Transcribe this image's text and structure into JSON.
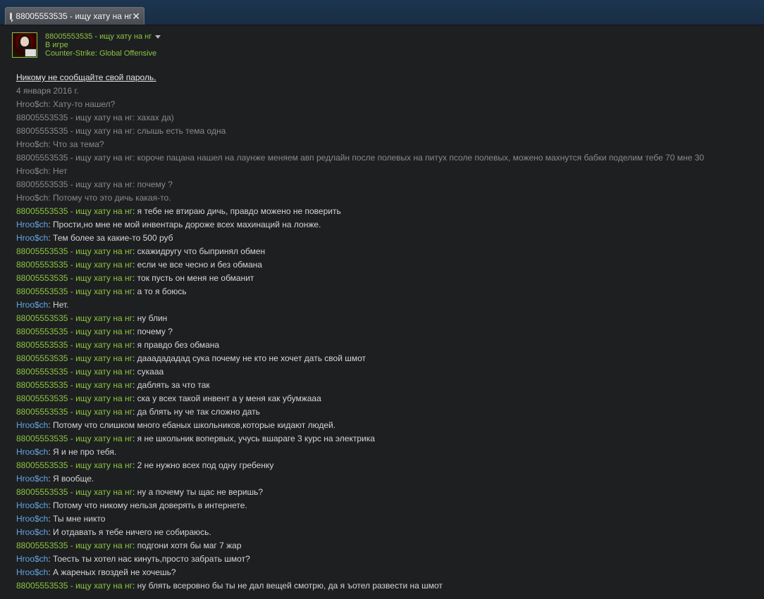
{
  "tab": {
    "title": "88005553535 - ищу хату на нг",
    "close": "✕"
  },
  "header": {
    "name": "88005553535 - ищу хату на нг",
    "status": "В игре",
    "game": "Counter-Strike: Global Offensive"
  },
  "warning": "Никому не сообщайте свой пароль.",
  "date": "4 января 2016 г.",
  "colors": {
    "friend": "#8bc53f",
    "self": "#62a7e3",
    "history": "#8a8a8a"
  },
  "messages": [
    {
      "sender": "Hroo$ch",
      "text": "Хату-то нашел?",
      "old": true,
      "self": true
    },
    {
      "sender": "88005553535 - ищу хату на нг",
      "text": "хахах да)",
      "old": true,
      "self": false
    },
    {
      "sender": "88005553535 - ищу хату на нг",
      "text": "слышь есть тема одна",
      "old": true,
      "self": false
    },
    {
      "sender": "Hroo$ch",
      "text": "Что за тема?",
      "old": true,
      "self": true
    },
    {
      "sender": "88005553535 - ищу хату на нг",
      "text": "короче пацана нашел на лаунже меняем авп редлайн после полевых на питух псоле полевых, можено махнутся бабки поделим тебе 70 мне 30",
      "old": true,
      "self": false
    },
    {
      "sender": "Hroo$ch",
      "text": "Нет",
      "old": true,
      "self": true
    },
    {
      "sender": "88005553535 - ищу хату на нг",
      "text": "почему ?",
      "old": true,
      "self": false
    },
    {
      "sender": "Hroo$ch",
      "text": "Потому что это дичь какая-то.",
      "old": true,
      "self": true
    },
    {
      "sender": "88005553535 - ищу хату на нг",
      "text": "я тебе не втираю дичь, правдо можено не поверить",
      "old": false,
      "self": false
    },
    {
      "sender": "Hroo$ch",
      "text": "Прости,но мне не мой инвентарь дороже всех махинаций на лонже.",
      "old": false,
      "self": true
    },
    {
      "sender": "Hroo$ch",
      "text": "Тем более за какие-то 500 руб",
      "old": false,
      "self": true
    },
    {
      "sender": "88005553535 - ищу хату на нг",
      "text": "скажидругу что быпринял обмен",
      "old": false,
      "self": false
    },
    {
      "sender": "88005553535 - ищу хату на нг",
      "text": "если че все чесно и без обмана",
      "old": false,
      "self": false
    },
    {
      "sender": "88005553535 - ищу хату на нг",
      "text": "ток пусть он меня не обманит",
      "old": false,
      "self": false
    },
    {
      "sender": "88005553535 - ищу хату на нг",
      "text": "а то я боюсь",
      "old": false,
      "self": false
    },
    {
      "sender": "Hroo$ch",
      "text": "Нет.",
      "old": false,
      "self": true
    },
    {
      "sender": "88005553535 - ищу хату на нг",
      "text": "ну блин",
      "old": false,
      "self": false
    },
    {
      "sender": "88005553535 - ищу хату на нг",
      "text": "почему ?",
      "old": false,
      "self": false
    },
    {
      "sender": "88005553535 - ищу хату на нг",
      "text": "я правдо без обмана",
      "old": false,
      "self": false
    },
    {
      "sender": "88005553535 - ищу хату на нг",
      "text": "дааадададад сука почему не кто не хочет дать свой  шмот",
      "old": false,
      "self": false
    },
    {
      "sender": "88005553535 - ищу хату на нг",
      "text": "сукааа",
      "old": false,
      "self": false
    },
    {
      "sender": "88005553535 - ищу хату на нг",
      "text": "даблять за что так",
      "old": false,
      "self": false
    },
    {
      "sender": "88005553535 - ищу хату на нг",
      "text": "ска у всех такой  инвент а у меня как убумжааа",
      "old": false,
      "self": false
    },
    {
      "sender": "88005553535 - ищу хату на нг",
      "text": "да блять ну че  так сложно дать",
      "old": false,
      "self": false
    },
    {
      "sender": "Hroo$ch",
      "text": "Потому что слишком много ебаных школьников,которые кидают людей.",
      "old": false,
      "self": true
    },
    {
      "sender": "88005553535 - ищу хату на нг",
      "text": "я не школьник вопервых, учусь вшараге 3 курс на электрика",
      "old": false,
      "self": false
    },
    {
      "sender": "Hroo$ch",
      "text": "Я и не про тебя.",
      "old": false,
      "self": true
    },
    {
      "sender": "88005553535 - ищу хату на нг",
      "text": "2 не  нужно всех под одну гребенку",
      "old": false,
      "self": false
    },
    {
      "sender": "Hroo$ch",
      "text": "Я вообще.",
      "old": false,
      "self": true
    },
    {
      "sender": "88005553535 - ищу хату на нг",
      "text": "ну а почему ты щас не веришь?",
      "old": false,
      "self": false
    },
    {
      "sender": "Hroo$ch",
      "text": "Потому что никому нельзя доверять в интернете.",
      "old": false,
      "self": true
    },
    {
      "sender": "Hroo$ch",
      "text": "Ты мне никто",
      "old": false,
      "self": true
    },
    {
      "sender": "Hroo$ch",
      "text": "И отдавать я тебе ничего не собираюсь.",
      "old": false,
      "self": true
    },
    {
      "sender": "88005553535 - ищу хату на нг",
      "text": "подгони хотя бы маг 7 жар",
      "old": false,
      "self": false
    },
    {
      "sender": "Hroo$ch",
      "text": "Тоесть ты хотел нас кинуть,просто забрать шмот?",
      "old": false,
      "self": true
    },
    {
      "sender": "Hroo$ch",
      "text": "А жареных гвоздей не хочешь?",
      "old": false,
      "self": true
    },
    {
      "sender": "88005553535 - ищу хату на нг",
      "text": "ну блять всеровно бы ты не дал вещей смотрю, да я ъотел развести на шмот",
      "old": false,
      "self": false
    }
  ]
}
